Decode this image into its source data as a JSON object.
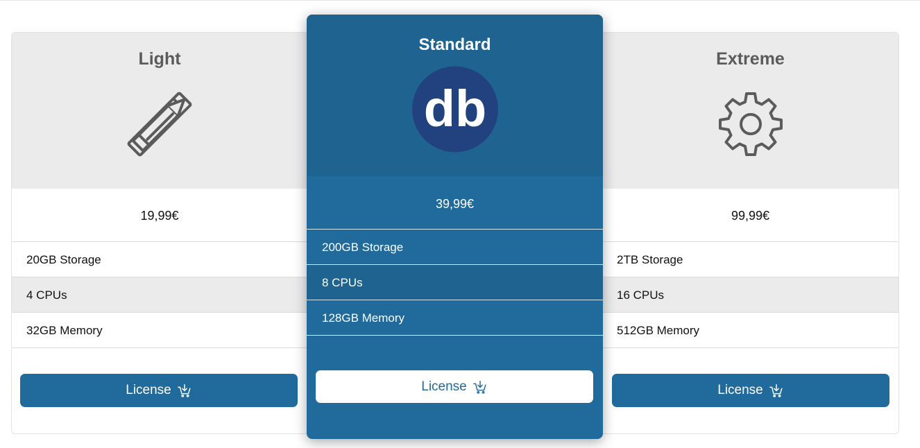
{
  "plans": [
    {
      "title": "Light",
      "icon": "pencil-ruler-icon",
      "price": "19,99€",
      "features": [
        "20GB Storage",
        "4 CPUs",
        "32GB Memory"
      ],
      "button_label": "License"
    },
    {
      "title": "Standard",
      "icon": "db-logo",
      "logo_text": "db",
      "price": "39,99€",
      "features": [
        "200GB Storage",
        "8 CPUs",
        "128GB Memory"
      ],
      "button_label": "License"
    },
    {
      "title": "Extreme",
      "icon": "gear-icon",
      "price": "99,99€",
      "features": [
        "2TB Storage",
        "16 CPUs",
        "512GB Memory"
      ],
      "button_label": "License"
    }
  ],
  "colors": {
    "primary": "#206b9c",
    "primary_dark": "#1f6391",
    "logo_circle": "#22427f",
    "header_gray": "#ebebeb",
    "icon_gray": "#5b5b5b"
  }
}
